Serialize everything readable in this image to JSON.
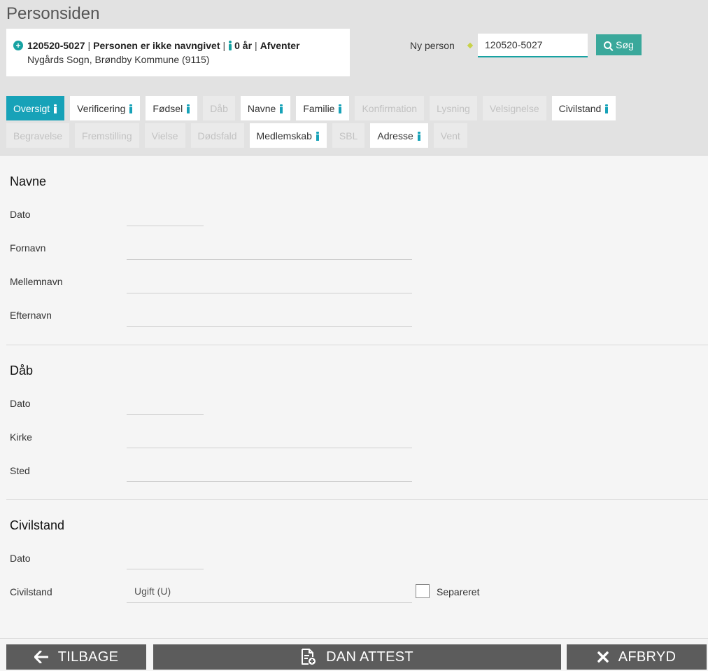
{
  "header": {
    "title": "Personsiden",
    "person": {
      "cpr": "120520-5027",
      "name_status": "Personen er ikke navngivet",
      "age": "0 år",
      "status": "Afventer",
      "location": "Nygårds Sogn, Brøndby Kommune (9115)"
    },
    "search": {
      "label": "Ny person",
      "value": "120520-5027",
      "button_label": "Søg"
    }
  },
  "tabs": {
    "row1": [
      {
        "label": "Oversigt",
        "state": "active",
        "info": true
      },
      {
        "label": "Verificering",
        "state": "enabled",
        "info": true
      },
      {
        "label": "Fødsel",
        "state": "enabled",
        "info": true
      },
      {
        "label": "Dåb",
        "state": "disabled",
        "info": false
      },
      {
        "label": "Navne",
        "state": "enabled",
        "info": true
      },
      {
        "label": "Familie",
        "state": "enabled",
        "info": true
      },
      {
        "label": "Konfirmation",
        "state": "disabled",
        "info": false
      },
      {
        "label": "Lysning",
        "state": "disabled",
        "info": false
      },
      {
        "label": "Velsignelse",
        "state": "disabled",
        "info": false
      },
      {
        "label": "Civilstand",
        "state": "enabled",
        "info": true
      }
    ],
    "row2": [
      {
        "label": "Begravelse",
        "state": "disabled",
        "info": false
      },
      {
        "label": "Fremstilling",
        "state": "disabled",
        "info": false
      },
      {
        "label": "Vielse",
        "state": "disabled",
        "info": false
      },
      {
        "label": "Dødsfald",
        "state": "disabled",
        "info": false
      },
      {
        "label": "Medlemskab",
        "state": "enabled",
        "info": true
      },
      {
        "label": "SBL",
        "state": "disabled",
        "info": false
      },
      {
        "label": "Adresse",
        "state": "enabled",
        "info": true
      },
      {
        "label": "Vent",
        "state": "disabled",
        "info": false
      }
    ]
  },
  "sections": {
    "navne": {
      "title": "Navne",
      "dato": "Dato",
      "fornavn": "Fornavn",
      "mellemnavn": "Mellemnavn",
      "efternavn": "Efternavn"
    },
    "daab": {
      "title": "Dåb",
      "dato": "Dato",
      "kirke": "Kirke",
      "sted": "Sted"
    },
    "civilstand": {
      "title": "Civilstand",
      "dato": "Dato",
      "civilstand": "Civilstand",
      "civilstand_value": "Ugift (U)",
      "separeret_label": "Separeret"
    }
  },
  "footer": {
    "back_label": "TILBAGE",
    "certificate_label": "DAN ATTEST",
    "cancel_label": "AFBRYD"
  },
  "colors": {
    "accent": "#17a2b8",
    "search_button": "#3aa89b",
    "footer_button": "#5c5c5c"
  }
}
